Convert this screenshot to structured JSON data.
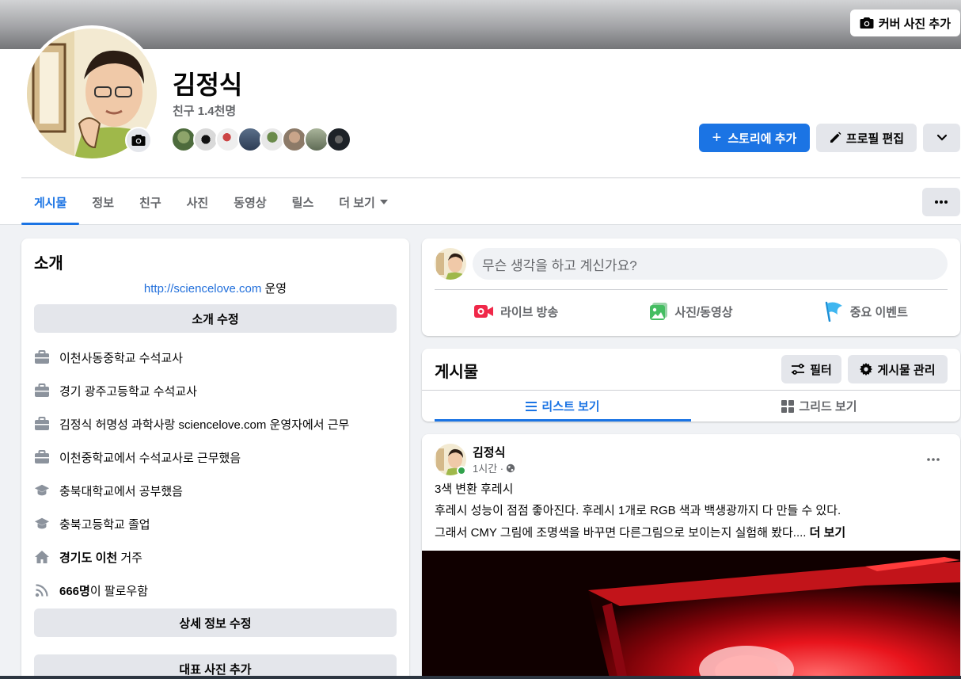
{
  "cover": {
    "add_cover_label": "커버 사진 추가"
  },
  "profile": {
    "name": "김정식",
    "friends": "친구 1.4천명",
    "story_label": "스토리에 추가",
    "edit_label": "프로필 편집"
  },
  "tabs": [
    {
      "label": "게시물"
    },
    {
      "label": "정보"
    },
    {
      "label": "친구"
    },
    {
      "label": "사진"
    },
    {
      "label": "동영상"
    },
    {
      "label": "릴스"
    },
    {
      "label": "더 보기"
    }
  ],
  "intro": {
    "title": "소개",
    "bio_link": "http://sciencelove.com",
    "bio_suffix": " 운영",
    "edit_bio_label": "소개 수정",
    "items": [
      {
        "icon": "briefcase-icon",
        "text": "이천사동중학교 수석교사"
      },
      {
        "icon": "briefcase-icon",
        "text": "경기 광주고등학교 수석교사"
      },
      {
        "icon": "briefcase-icon",
        "text": "김정식 허명성 과학사랑 sciencelove.com 운영자에서 근무"
      },
      {
        "icon": "briefcase-icon",
        "text": "이천중학교에서 수석교사로 근무했음"
      },
      {
        "icon": "graduation-cap-icon",
        "text": "충북대학교에서 공부했음"
      },
      {
        "icon": "graduation-cap-icon",
        "text": "충북고등학교 졸업"
      },
      {
        "icon": "home-icon",
        "bold": "경기도 이천",
        "text": " 거주"
      },
      {
        "icon": "rss-icon",
        "bold": "666명",
        "text": "이 팔로우함"
      }
    ],
    "edit_details_label": "상세 정보 수정",
    "add_featured_label": "대표 사진 추가"
  },
  "composer": {
    "placeholder": "무슨 생각을 하고 계신가요?",
    "actions": [
      {
        "icon": "live-video-icon",
        "label": "라이브 방송",
        "color": "#f02849"
      },
      {
        "icon": "photo-video-icon",
        "label": "사진/동영상",
        "color": "#45bd62"
      },
      {
        "icon": "flag-icon",
        "label": "중요 이벤트",
        "color": "#1b8ed6"
      }
    ]
  },
  "posts_header": {
    "title": "게시물",
    "filter_label": "필터",
    "manage_label": "게시물 관리",
    "list_view_label": "리스트 보기",
    "grid_view_label": "그리드 보기"
  },
  "post": {
    "author": "김정식",
    "time": "1시간 ·",
    "lines": [
      "3색 변환 후레시",
      "후레시 성능이 점점 좋아진다. 후레시 1개로 RGB 색과 백생광까지 다 만들 수 있다.",
      "그래서 CMY 그림에 조명색을 바꾸면 다른그림으로 보이는지 실험해 봤다.... "
    ],
    "see_more": "더 보기"
  },
  "colors": {
    "accent": "#1b74e4",
    "secondary_btn": "#e4e6eb",
    "page_bg": "#f0f2f5"
  }
}
